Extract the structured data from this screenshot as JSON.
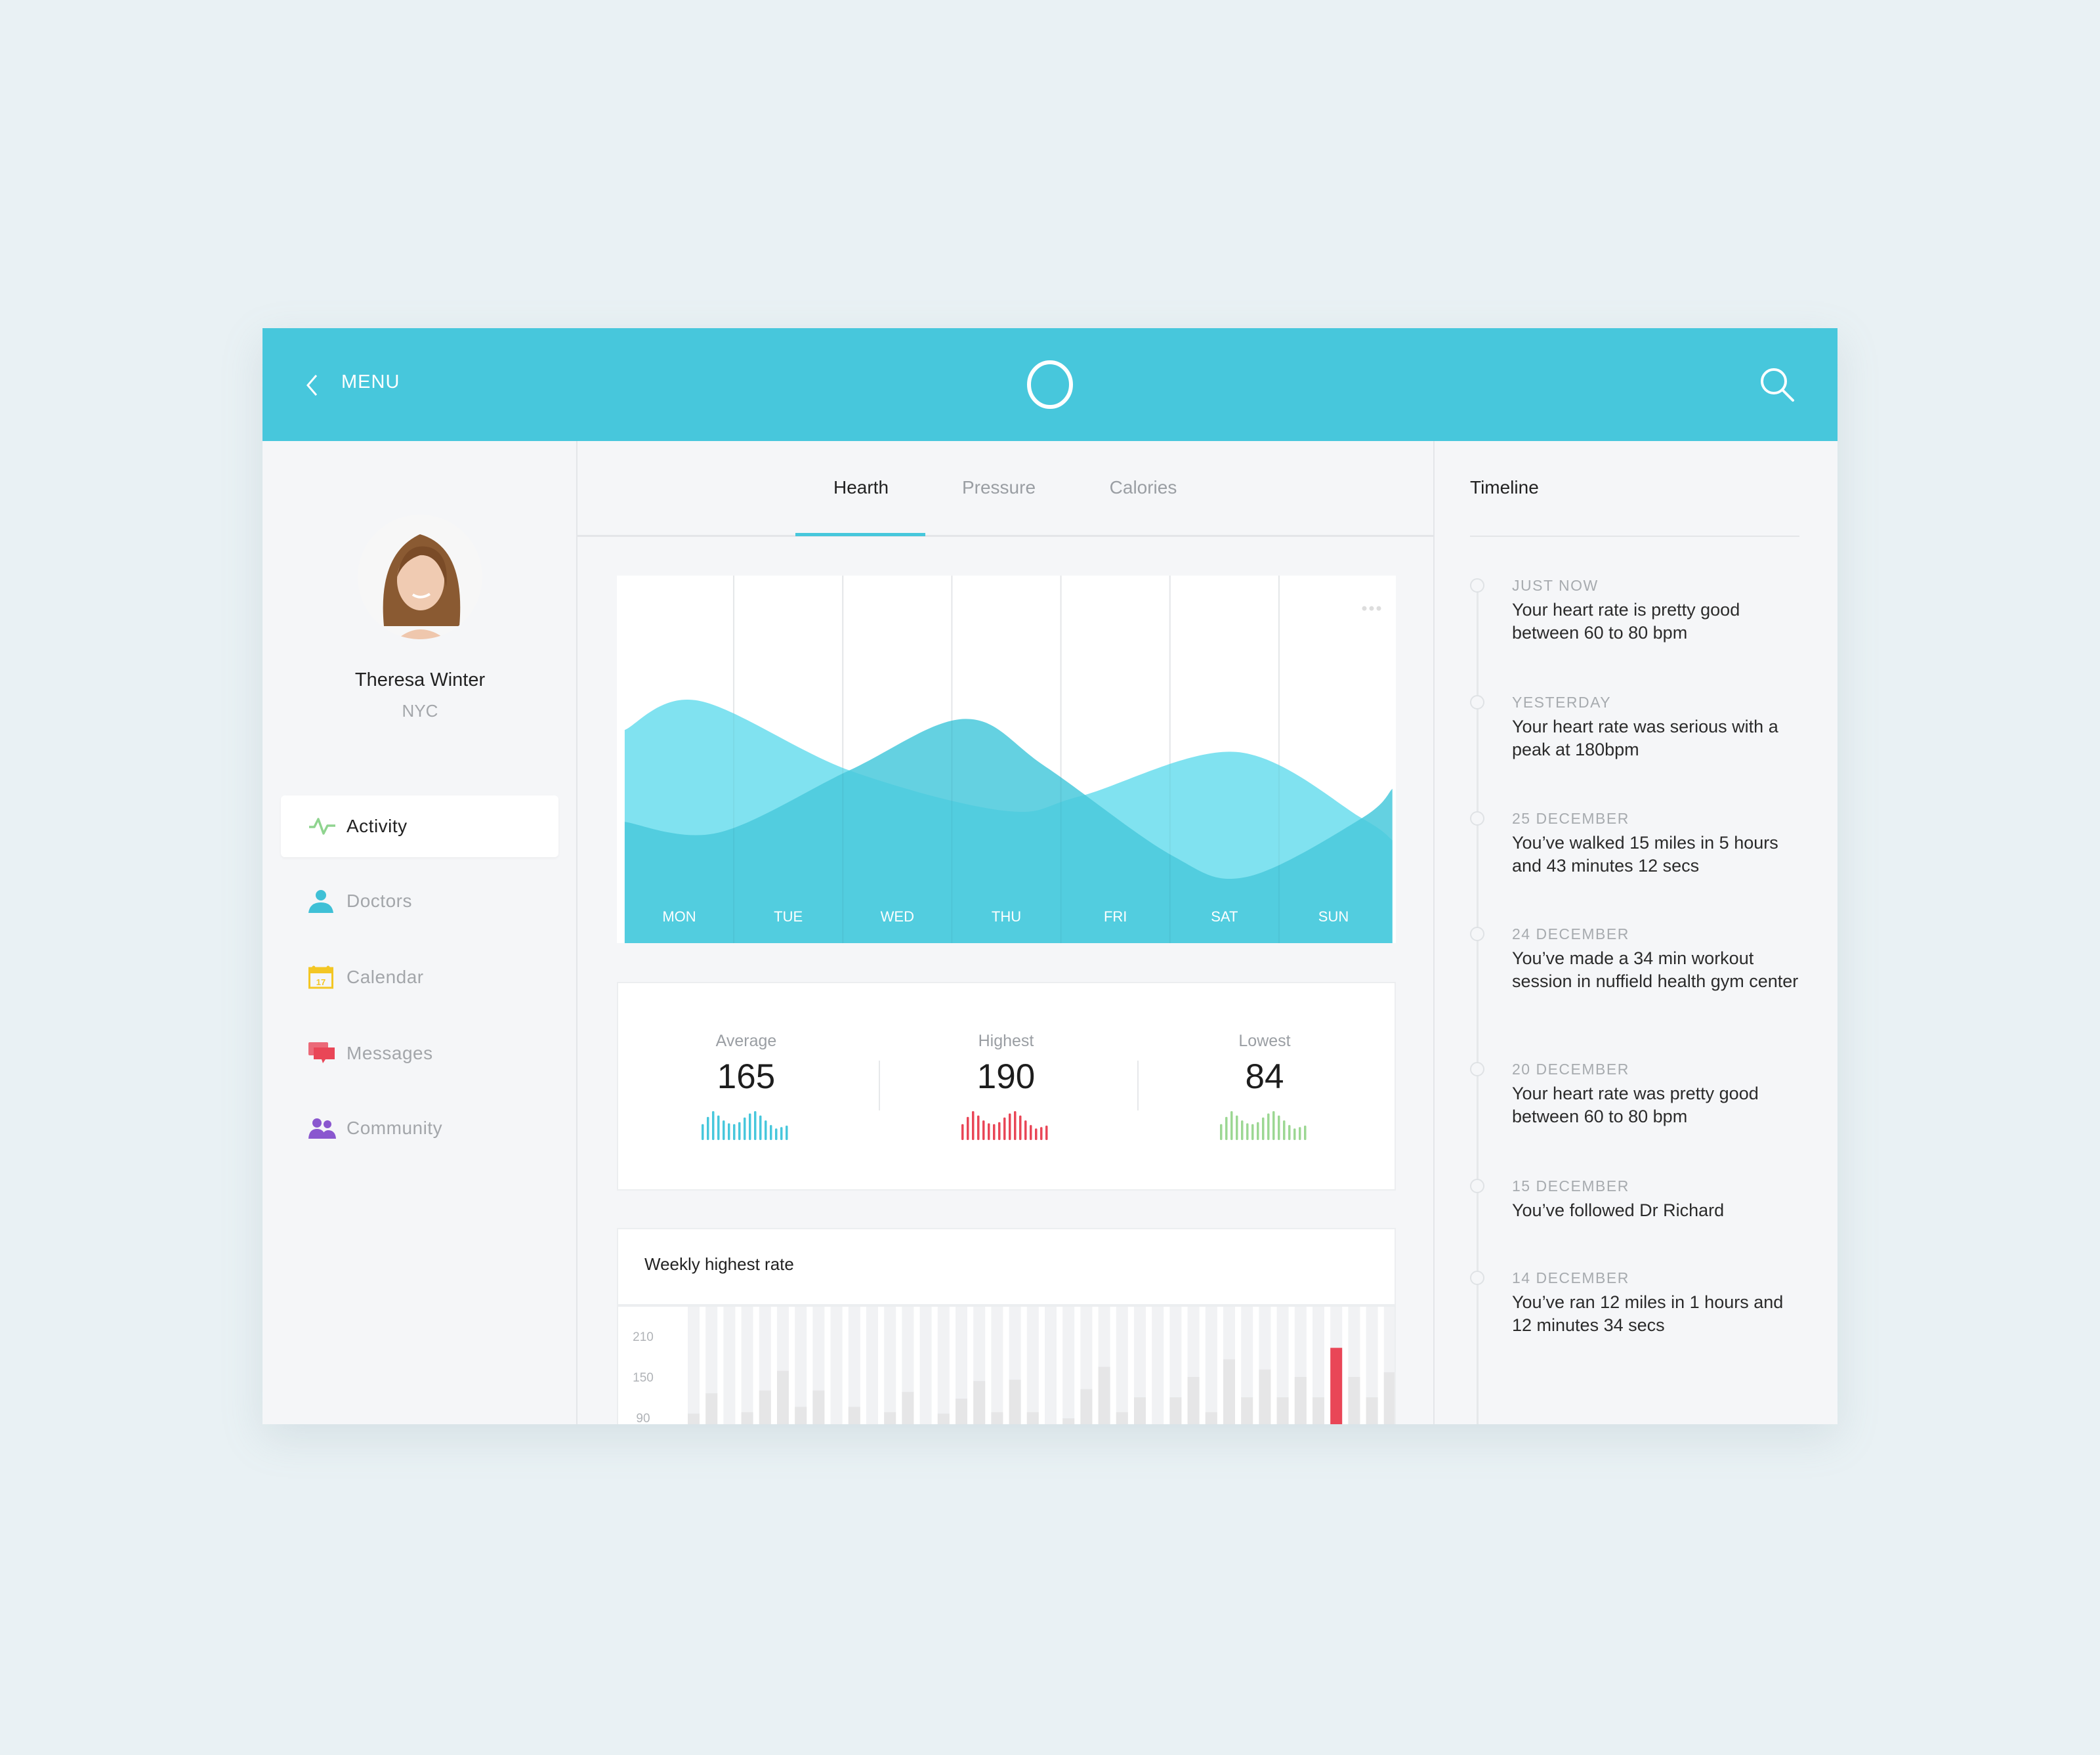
{
  "header": {
    "back_label": "MENU",
    "logo_icon": "ring-logo-icon",
    "search_icon": "search-icon",
    "accent": "#47c7dc"
  },
  "profile": {
    "name": "Theresa Winter",
    "location": "NYC"
  },
  "sidebar": {
    "items": [
      {
        "label": "Activity",
        "icon": "pulse-icon",
        "color": "#8fd48f",
        "active": true
      },
      {
        "label": "Doctors",
        "icon": "user-icon",
        "color": "#3fc0d6"
      },
      {
        "label": "Calendar",
        "icon": "calendar-icon",
        "color": "#f3c623",
        "icon_text": "17"
      },
      {
        "label": "Messages",
        "icon": "chat-icon",
        "color": "#e94657"
      },
      {
        "label": "Community",
        "icon": "group-icon",
        "color": "#8a57cf"
      }
    ]
  },
  "tabs": [
    {
      "label": "Hearth",
      "active": true
    },
    {
      "label": "Pressure"
    },
    {
      "label": "Calories"
    }
  ],
  "chart_data": [
    {
      "type": "area",
      "categories": [
        "MON",
        "TUE",
        "WED",
        "THU",
        "FRI",
        "SAT",
        "SUN"
      ],
      "series": [
        {
          "color": "#80e2f0",
          "x": [
            -0.5,
            0.17,
            1.56,
            2.99,
            3.68,
            5.11,
            6.26,
            6.54
          ],
          "values": [
            58,
            66,
            47,
            36,
            40,
            52,
            34,
            28
          ]
        },
        {
          "color": "#4ac9dc",
          "x": [
            -0.5,
            0.35,
            1.56,
            2.62,
            3.36,
            4.51,
            5.2,
            6.26,
            6.54
          ],
          "values": [
            33,
            30,
            47,
            61,
            48,
            24,
            18,
            34,
            42
          ]
        }
      ],
      "menu_icon": "more-dots-icon"
    },
    {
      "type": "bar",
      "title": "Weekly highest rate",
      "y_ticks": [
        210,
        150,
        90
      ],
      "ylim": [
        80,
        240
      ],
      "highlight_color": "#e94657",
      "highlight_index": 36,
      "values": [
        96,
        126,
        null,
        98,
        130,
        159,
        106,
        130,
        null,
        106,
        null,
        98,
        128,
        null,
        96,
        118,
        144,
        98,
        146,
        98,
        null,
        89,
        132,
        165,
        98,
        120,
        null,
        120,
        150,
        98,
        176,
        120,
        161,
        120,
        150,
        120,
        193,
        150,
        120,
        157
      ]
    }
  ],
  "stats": [
    {
      "label": "Average",
      "value": "165",
      "color": "#47c7dc"
    },
    {
      "label": "Highest",
      "value": "190",
      "color": "#e94657"
    },
    {
      "label": "Lowest",
      "value": "84",
      "color": "#9cd793"
    }
  ],
  "sparkline": [
    0.55,
    0.8,
    1,
    0.85,
    0.68,
    0.58,
    0.55,
    0.62,
    0.78,
    0.92,
    1,
    0.85,
    0.68,
    0.52,
    0.4,
    0.45,
    0.5
  ],
  "timeline": {
    "title": "Timeline",
    "items": [
      {
        "date": "JUST NOW",
        "text": "Your heart rate is pretty good between 60 to 80 bpm"
      },
      {
        "date": "YESTERDAY",
        "text": "Your heart rate was serious with a peak at 180bpm"
      },
      {
        "date": "25 DECEMBER",
        "text": "You’ve walked 15 miles in 5 hours and 43 minutes 12 secs"
      },
      {
        "date": "24 DECEMBER",
        "text": "You’ve made a 34 min workout session in nuffield health gym center"
      },
      {
        "date": "20 DECEMBER",
        "text": "Your heart rate was pretty good between 60 to 80 bpm"
      },
      {
        "date": "15 DECEMBER",
        "text": "You’ve followed Dr Richard"
      },
      {
        "date": "14 DECEMBER",
        "text": "You’ve ran 12 miles in 1 hours and 12 minutes 34 secs"
      }
    ]
  }
}
